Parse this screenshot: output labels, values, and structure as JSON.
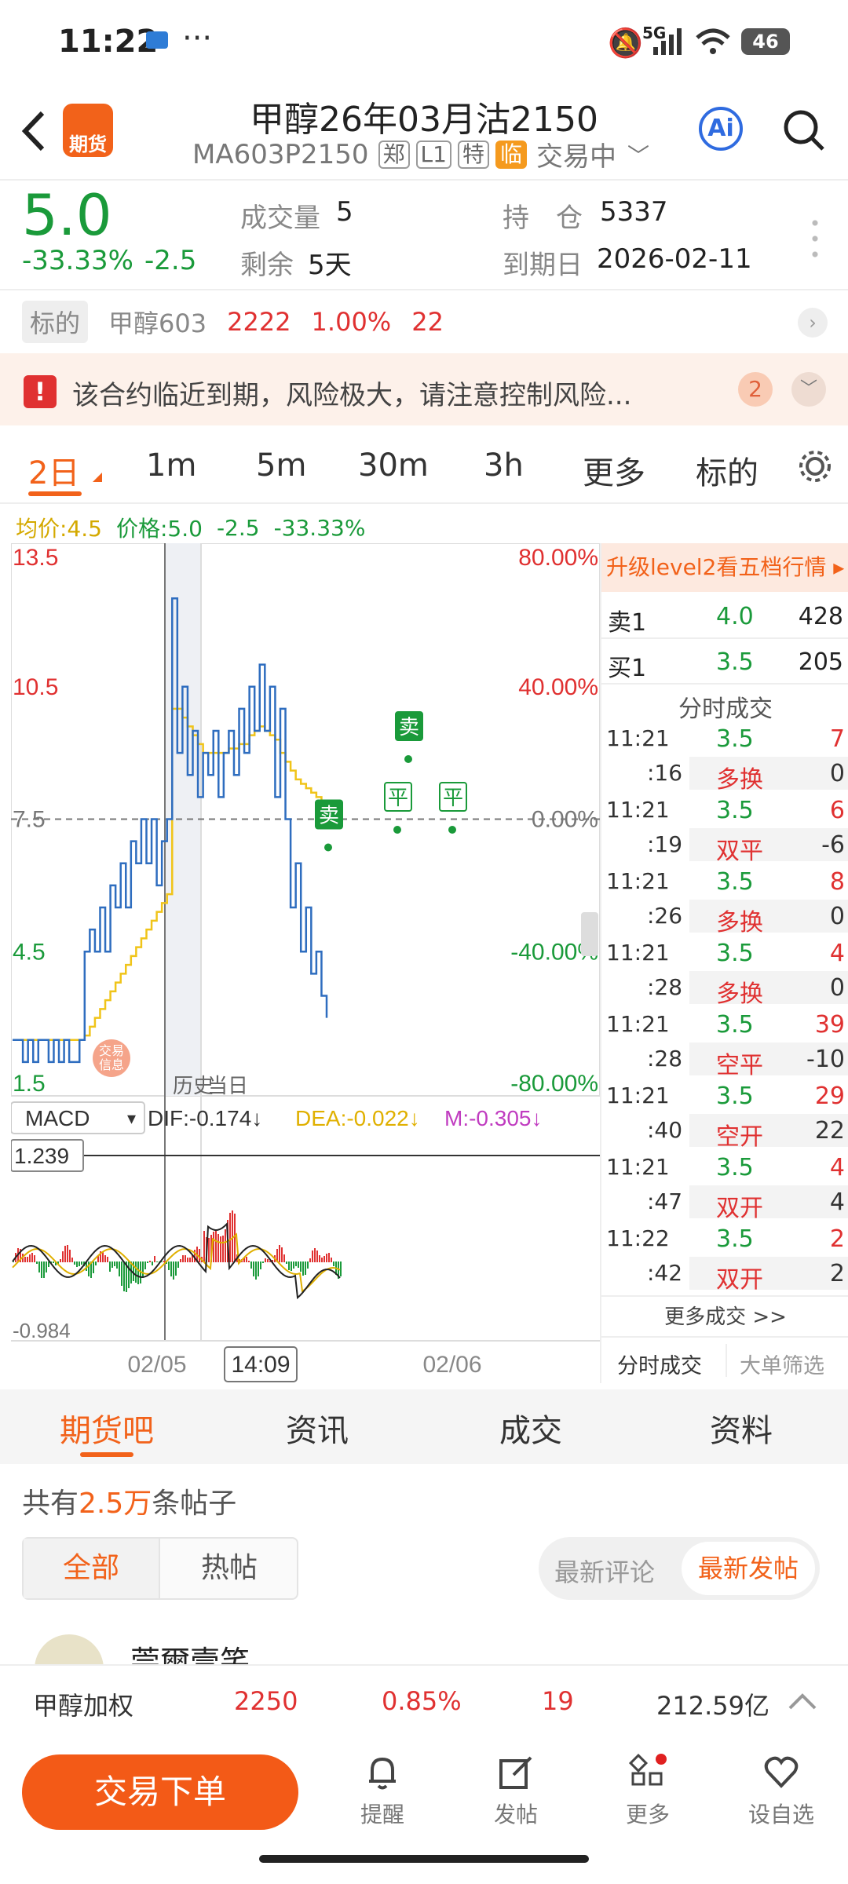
{
  "status_bar": {
    "time": "11:22",
    "net": "5G",
    "battery": "46"
  },
  "header": {
    "title": "甲醇26年03月沽2150",
    "code": "MA603P2150",
    "tags": [
      "郑",
      "L1",
      "特",
      "临"
    ],
    "state": "交易中",
    "logo_text": "期货",
    "ai_label": "Ai"
  },
  "quote": {
    "price": "5.0",
    "change_pct": "-33.33%",
    "change": "-2.5",
    "volume_label": "成交量",
    "volume": "5",
    "remain_label": "剩余",
    "remain": "5天",
    "oi_label": "持　仓",
    "oi": "5337",
    "expiry_label": "到期日",
    "expiry": "2026-02-11"
  },
  "underlying": {
    "label": "标的",
    "name": "甲醇603",
    "price": "2222",
    "pct": "1.00%",
    "chg": "22"
  },
  "alert": {
    "text": "该合约临近到期，风险极大，请注意控制风险...",
    "count": "2"
  },
  "tabs": [
    "2日",
    "1m",
    "5m",
    "30m",
    "3h",
    "更多",
    "标的"
  ],
  "legend": {
    "avg": "均价:4.5",
    "price": "价格:5.0",
    "chg": "-2.5",
    "pct": "-33.33%"
  },
  "chart_data": {
    "type": "line",
    "y_left": [
      "13.5",
      "10.5",
      "7.5",
      "4.5",
      "1.5"
    ],
    "y_right": [
      "80.00%",
      "40.00%",
      "0.00%",
      "-40.00%",
      "-80.00%"
    ],
    "x_labels": [
      "02/05",
      "14:09",
      "02/06"
    ],
    "segment_labels": [
      "历史",
      "当日"
    ],
    "markers": [
      "卖",
      "卖",
      "平",
      "平"
    ],
    "badge": "交易信息",
    "series": [
      {
        "name": "价格",
        "values": [
          2.5,
          2.5,
          2.0,
          2.5,
          2.0,
          2.5,
          2.5,
          2.0,
          2.5,
          2.0,
          2.5,
          2.0,
          2.0,
          2.5,
          4.5,
          5.0,
          4.5,
          5.5,
          4.5,
          6.0,
          5.5,
          6.5,
          5.5,
          7.0,
          6.5,
          7.5,
          6.5,
          7.5,
          6.0,
          7.0,
          7.5,
          12.5,
          9.0,
          10.5,
          8.5,
          9.5,
          8.0,
          9.0,
          8.5,
          9.5,
          8.0,
          9.0,
          9.5,
          8.5,
          10.0,
          9.0,
          10.5,
          9.5,
          11.0,
          9.5,
          10.5,
          8.0,
          10.0,
          7.5,
          5.5,
          6.5,
          4.5,
          5.5,
          4.0,
          4.5,
          3.5,
          3.0
        ]
      },
      {
        "name": "均价",
        "values": [
          2.5,
          2.5,
          2.5,
          2.5,
          2.5,
          2.5,
          2.5,
          2.5,
          2.5,
          2.5,
          2.5,
          2.5,
          2.5,
          2.5,
          2.6,
          2.8,
          3.0,
          3.2,
          3.4,
          3.6,
          3.8,
          4.0,
          4.2,
          4.4,
          4.6,
          4.8,
          5.0,
          5.2,
          5.4,
          5.6,
          5.8,
          10.0,
          10.0,
          9.8,
          9.6,
          9.4,
          9.2,
          9.0,
          9.0,
          9.0,
          9.0,
          9.0,
          9.1,
          9.1,
          9.2,
          9.2,
          9.4,
          9.5,
          9.6,
          9.5,
          9.4,
          9.3,
          9.0,
          8.8,
          8.6,
          8.4,
          8.3,
          8.2,
          8.1,
          8.0,
          7.9,
          7.8
        ]
      }
    ]
  },
  "macd": {
    "label": "MACD",
    "dif": "DIF:-0.174↓",
    "dea": "DEA:-0.022↓",
    "m": "M:-0.305↓",
    "top": "1.239",
    "bottom": "-0.984"
  },
  "side": {
    "upgrade": "升级level2看五档行情 ▸",
    "ask_label": "卖1",
    "ask_price": "4.0",
    "ask_vol": "428",
    "bid_label": "买1",
    "bid_price": "3.5",
    "bid_vol": "205",
    "title": "分时成交",
    "trades": [
      {
        "t1": "11:21",
        "p": "3.5",
        "v": "7",
        "t2": ":16",
        "type": "多换",
        "d": "0"
      },
      {
        "t1": "11:21",
        "p": "3.5",
        "v": "6",
        "t2": ":19",
        "type": "双平",
        "d": "-6"
      },
      {
        "t1": "11:21",
        "p": "3.5",
        "v": "8",
        "t2": ":26",
        "type": "多换",
        "d": "0"
      },
      {
        "t1": "11:21",
        "p": "3.5",
        "v": "4",
        "t2": ":28",
        "type": "多换",
        "d": "0"
      },
      {
        "t1": "11:21",
        "p": "3.5",
        "v": "39",
        "t2": ":28",
        "type": "空平",
        "d": "-10"
      },
      {
        "t1": "11:21",
        "p": "3.5",
        "v": "29",
        "t2": ":40",
        "type": "空开",
        "d": "22"
      },
      {
        "t1": "11:21",
        "p": "3.5",
        "v": "4",
        "t2": ":47",
        "type": "双开",
        "d": "4"
      },
      {
        "t1": "11:22",
        "p": "3.5",
        "v": "2",
        "t2": ":42",
        "type": "双开",
        "d": "2"
      }
    ],
    "more": "更多成交 >>",
    "tab1": "分时成交",
    "tab2": "大单筛选"
  },
  "bottom_tabs": [
    "期货吧",
    "资讯",
    "成交",
    "资料"
  ],
  "posts": {
    "prefix": "共有",
    "count": "2.5万",
    "suffix": "条帖子",
    "filter1": "全部",
    "filter2": "热帖",
    "sort1": "最新评论",
    "sort2": "最新发帖",
    "user": "莞爾壹笑"
  },
  "footer_ticker": {
    "name": "甲醇加权",
    "price": "2250",
    "pct": "0.85%",
    "chg": "19",
    "amount": "212.59亿"
  },
  "nav": {
    "order": "交易下单",
    "remind": "提醒",
    "post": "发帖",
    "more": "更多",
    "watch": "设自选"
  }
}
